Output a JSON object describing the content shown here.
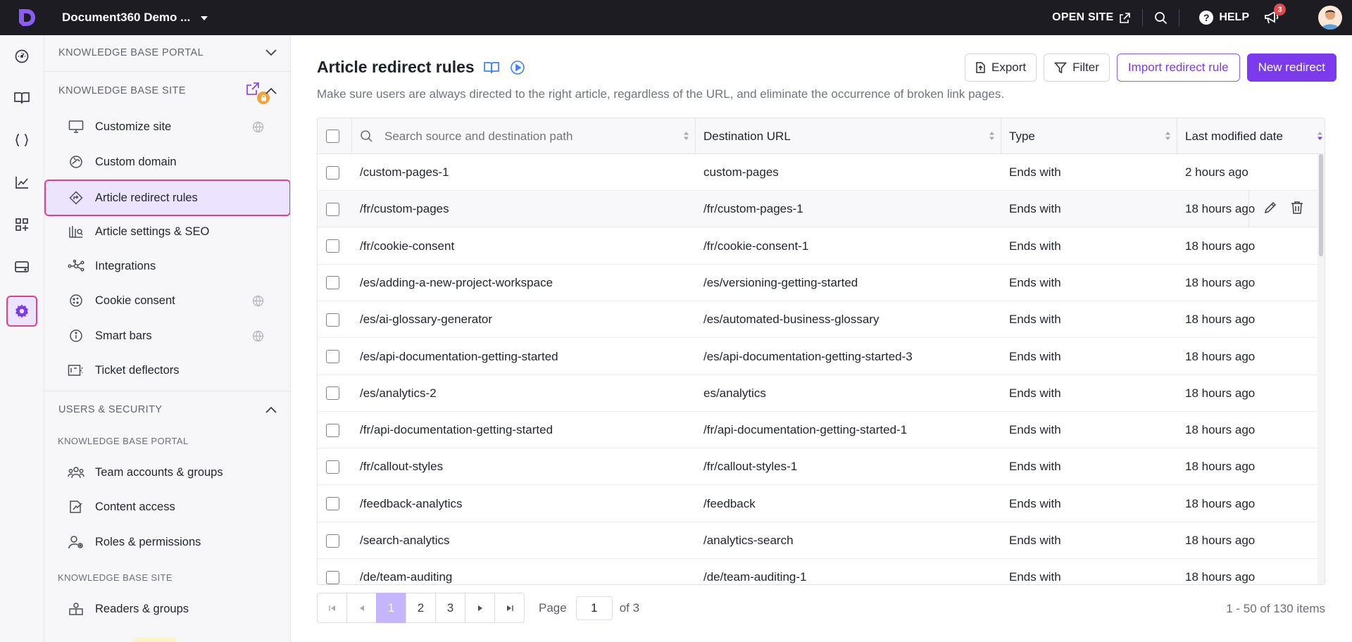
{
  "topbar": {
    "project_name": "Document360 Demo ...",
    "open_site_label": "OPEN SITE",
    "help_label": "HELP",
    "notification_count": "3"
  },
  "sidebar": {
    "section1_title": "KNOWLEDGE BASE PORTAL",
    "section2_title": "KNOWLEDGE BASE SITE",
    "kb_site_items": [
      {
        "label": "Customize site",
        "icon": "monitor-icon"
      },
      {
        "label": "Custom domain",
        "icon": "domain-icon"
      },
      {
        "label": "Article redirect rules",
        "icon": "redirect-icon"
      },
      {
        "label": "Article settings & SEO",
        "icon": "seo-icon"
      },
      {
        "label": "Integrations",
        "icon": "integrations-icon"
      },
      {
        "label": "Cookie consent",
        "icon": "cookie-icon"
      },
      {
        "label": "Smart bars",
        "icon": "info-icon"
      },
      {
        "label": "Ticket deflectors",
        "icon": "ticket-icon"
      }
    ],
    "section3_title": "USERS & SECURITY",
    "sub1_title": "KNOWLEDGE BASE PORTAL",
    "users_portal_items": [
      {
        "label": "Team accounts & groups"
      },
      {
        "label": "Content access"
      },
      {
        "label": "Roles & permissions"
      }
    ],
    "sub2_title": "KNOWLEDGE BASE SITE",
    "users_site_items": [
      {
        "label": "Readers & groups"
      }
    ]
  },
  "main": {
    "title": "Article redirect rules",
    "subtitle": "Make sure users are always directed to the right article, regardless of the URL, and eliminate the occurrence of broken link pages.",
    "buttons": {
      "export": "Export",
      "filter": "Filter",
      "import": "Import redirect rule",
      "new": "New redirect"
    },
    "table": {
      "search_placeholder": "Search source and destination path",
      "col_destination": "Destination URL",
      "col_type": "Type",
      "col_modified": "Last modified date",
      "rows": [
        {
          "source": "/custom-pages-1",
          "destination": "custom-pages",
          "type": "Ends with",
          "modified": "2 hours ago"
        },
        {
          "source": "/fr/custom-pages",
          "destination": "/fr/custom-pages-1",
          "type": "Ends with",
          "modified": "18 hours ago"
        },
        {
          "source": "/fr/cookie-consent",
          "destination": "/fr/cookie-consent-1",
          "type": "Ends with",
          "modified": "18 hours ago"
        },
        {
          "source": "/es/adding-a-new-project-workspace",
          "destination": "/es/versioning-getting-started",
          "type": "Ends with",
          "modified": "18 hours ago"
        },
        {
          "source": "/es/ai-glossary-generator",
          "destination": "/es/automated-business-glossary",
          "type": "Ends with",
          "modified": "18 hours ago"
        },
        {
          "source": "/es/api-documentation-getting-started",
          "destination": "/es/api-documentation-getting-started-3",
          "type": "Ends with",
          "modified": "18 hours ago"
        },
        {
          "source": "/es/analytics-2",
          "destination": "es/analytics",
          "type": "Ends with",
          "modified": "18 hours ago"
        },
        {
          "source": "/fr/api-documentation-getting-started",
          "destination": "/fr/api-documentation-getting-started-1",
          "type": "Ends with",
          "modified": "18 hours ago"
        },
        {
          "source": "/fr/callout-styles",
          "destination": "/fr/callout-styles-1",
          "type": "Ends with",
          "modified": "18 hours ago"
        },
        {
          "source": "/feedback-analytics",
          "destination": "/feedback",
          "type": "Ends with",
          "modified": "18 hours ago"
        },
        {
          "source": "/search-analytics",
          "destination": "/analytics-search",
          "type": "Ends with",
          "modified": "18 hours ago"
        },
        {
          "source": "/de/team-auditing",
          "destination": "/de/team-auditing-1",
          "type": "Ends with",
          "modified": "18 hours ago"
        }
      ]
    },
    "pagination": {
      "pages": [
        "1",
        "2",
        "3"
      ],
      "page_label": "Page",
      "current_page": "1",
      "of_label": "of 3",
      "items_summary": "1 - 50 of 130 items"
    }
  },
  "colors": {
    "accent": "#7c3aed",
    "highlight_border": "#e0418a",
    "topbar_bg": "#1c1c22"
  }
}
